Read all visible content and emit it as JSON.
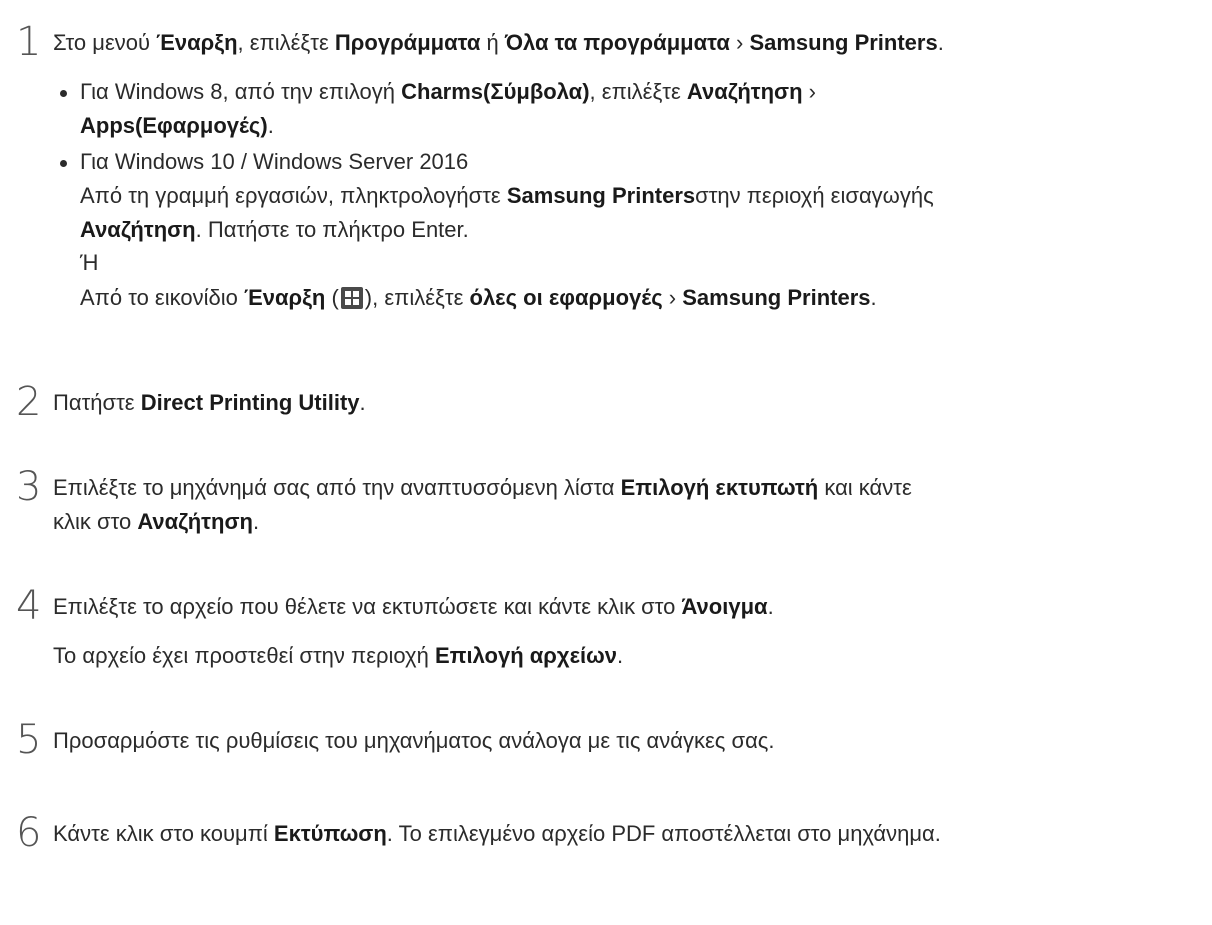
{
  "steps": [
    {
      "number": "1",
      "intro": "Στο μενού ",
      "b1": "Έναρξη",
      "t1": ", επιλέξτε ",
      "b2": "Προγράμματα",
      "t2": " ή ",
      "b3": "Όλα τα προγράμματα",
      "t3": " › ",
      "b4": "Samsung Printers",
      "t4": "."
    },
    {
      "number": "2",
      "intro": "Πατήστε ",
      "b1": "Direct Printing Utility",
      "t1": "."
    },
    {
      "number": "3",
      "intro": "Επιλέξτε το μηχάνημά σας από την αναπτυσσόμενη λίστα ",
      "b1": "Επιλογή εκτυπωτή",
      "t1": " και κάντε",
      "line2_intro": "κλικ στο ",
      "b2": "Αναζήτηση",
      "t2": "."
    },
    {
      "number": "4",
      "intro": "Επιλέξτε το αρχείο που θέλετε να εκτυπώσετε και κάντε κλικ στο ",
      "b1": "Άνοιγμα",
      "t1": ".",
      "note_intro": "Το αρχείο έχει προστεθεί στην περιοχή ",
      "note_b": "Επιλογή αρχείων",
      "note_end": "."
    },
    {
      "number": "5",
      "intro": "Προσαρμόστε τις ρυθμίσεις του μηχανήματος ανάλογα με τις ανάγκες σας."
    },
    {
      "number": "6",
      "intro": "Κάντε κλικ στο κουμπί ",
      "b1": "Εκτύπωση",
      "t1": ". Το επιλεγμένο αρχείο PDF αποστέλλεται στο μηχάνημα."
    }
  ],
  "bullets": {
    "win8": {
      "intro": "Για Windows 8, από την επιλογή ",
      "b1": "Charms(Σύμβολα)",
      "t1": ", επιλέξτε ",
      "b2": "Αναζήτηση",
      "t2": " ›",
      "b3": "Apps(Εφαρμογές)",
      "t3": "."
    },
    "win10": {
      "title": "Για Windows 10 / Windows Server 2016",
      "l2_intro": "Από τη γραμμή εργασιών, πληκτρολογήστε ",
      "l2_b": "Samsung Printers",
      "l2_end": "στην περιοχή εισαγωγής",
      "l3_b": "Αναζήτηση",
      "l3_end": ". Πατήστε το πλήκτρο Enter.",
      "or": "Ή",
      "l5_intro": "Από το εικονίδιο ",
      "l5_b1": "Έναρξη",
      "l5_t1": " (",
      "l5_t2": "), επιλέξτε ",
      "l5_b2": "όλες οι εφαρμογές",
      "l5_t3": " › ",
      "l5_b3": "Samsung Printers",
      "l5_t4": "."
    }
  },
  "icons": {
    "start_icon": "windows-start-icon"
  }
}
